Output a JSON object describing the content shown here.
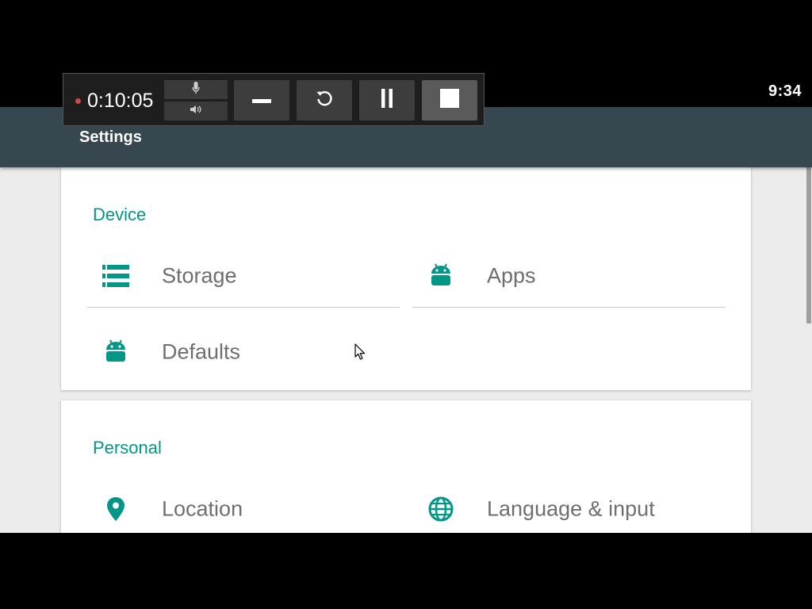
{
  "status_bar": {
    "time": "9:34"
  },
  "recorder": {
    "elapsed": "0:10:05",
    "buttons": [
      {
        "name": "minimize",
        "icon": "minus-icon"
      },
      {
        "name": "restart",
        "icon": "refresh-icon"
      },
      {
        "name": "pause",
        "icon": "pause-icon"
      },
      {
        "name": "stop",
        "icon": "stop-icon"
      }
    ],
    "audio": [
      {
        "name": "microphone",
        "icon": "mic-icon"
      },
      {
        "name": "speaker",
        "icon": "speaker-icon"
      }
    ],
    "recording_color": "#d64545"
  },
  "app_bar": {
    "title": "Settings",
    "color": "#37474f"
  },
  "colors": {
    "accent": "#009688",
    "label": "#6e6e6e",
    "background": "#ececec"
  },
  "sections": [
    {
      "title": "Device",
      "items": [
        {
          "label": "Storage",
          "icon": "storage-icon"
        },
        {
          "label": "Apps",
          "icon": "android-icon"
        },
        {
          "label": "Defaults",
          "icon": "android-icon"
        }
      ]
    },
    {
      "title": "Personal",
      "items": [
        {
          "label": "Location",
          "icon": "location-pin-icon"
        },
        {
          "label": "Language & input",
          "icon": "globe-icon"
        }
      ]
    }
  ]
}
